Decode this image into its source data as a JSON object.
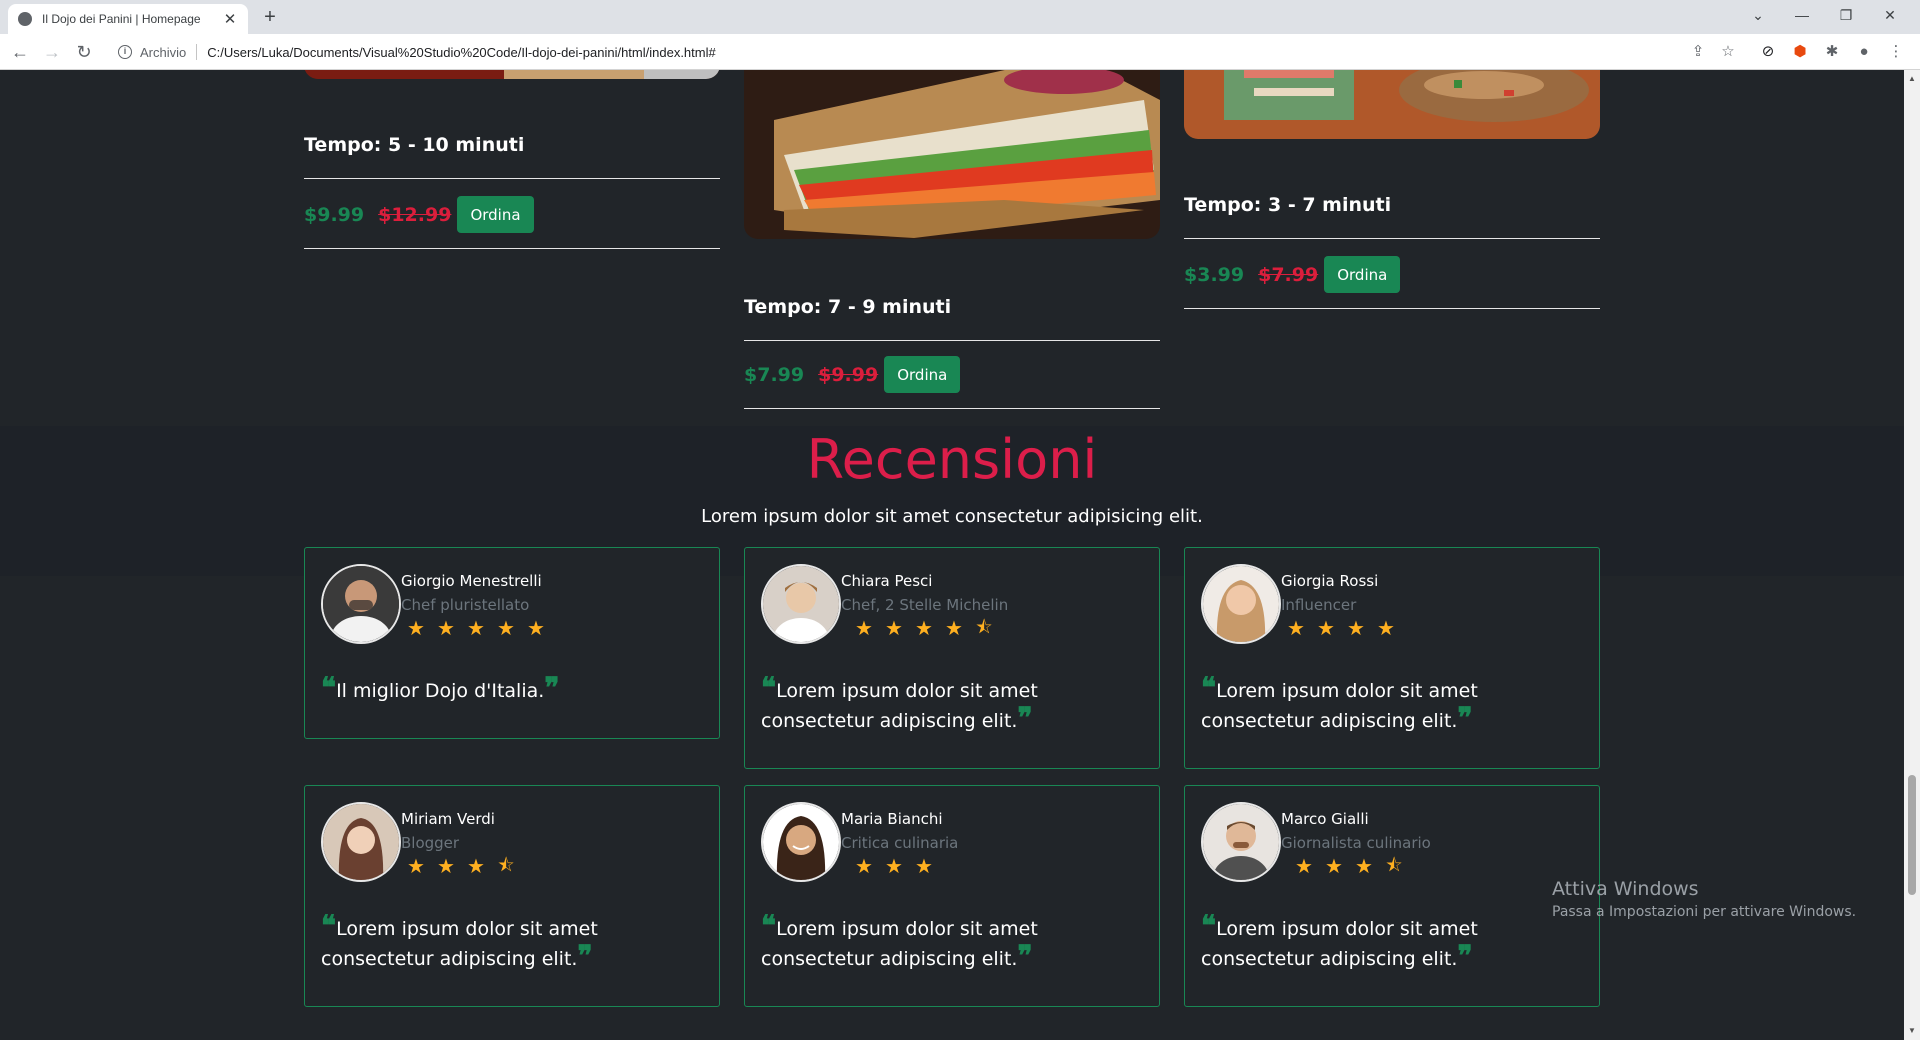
{
  "browser": {
    "tab_title": "Il Dojo dei Panini | Homepage",
    "new_tab": "+",
    "archivio": "Archivio",
    "url": "C:/Users/Luka/Documents/Visual%20Studio%20Code/Il-dojo-dei-panini/html/index.html#"
  },
  "menu": [
    {
      "tempo": "Tempo: 5 - 10 minuti",
      "price": "$9.99",
      "old_price": "$12.99",
      "button": "Ordina"
    },
    {
      "tempo": "Tempo: 7 - 9 minuti",
      "price": "$7.99",
      "old_price": "$9.99",
      "button": "Ordina"
    },
    {
      "tempo": "Tempo: 3 - 7 minuti",
      "price": "$3.99",
      "old_price": "$7.99",
      "button": "Ordina"
    }
  ],
  "reviews_section": {
    "title": "Recensioni",
    "subtitle": "Lorem ipsum dolor sit amet consectetur adipisicing elit."
  },
  "reviews": [
    {
      "name": "Giorgio Menestrelli",
      "role": "Chef pluristellato",
      "rating": 5,
      "quote": "Il miglior Dojo d'Italia."
    },
    {
      "name": "Chiara Pesci",
      "role": "Chef, 2 Stelle Michelin",
      "rating": 4.5,
      "quote": "Lorem ipsum dolor sit amet consectetur adipiscing elit."
    },
    {
      "name": "Giorgia Rossi",
      "role": "Influencer",
      "rating": 4,
      "quote": "Lorem ipsum dolor sit amet consectetur adipiscing elit."
    },
    {
      "name": "Miriam Verdi",
      "role": "Blogger",
      "rating": 3.5,
      "quote": "Lorem ipsum dolor sit amet consectetur adipiscing elit."
    },
    {
      "name": "Maria Bianchi",
      "role": "Critica culinaria",
      "rating": 3,
      "quote": "Lorem ipsum dolor sit amet consectetur adipiscing elit."
    },
    {
      "name": "Marco Gialli",
      "role": "Giornalista culinario",
      "rating": 3.5,
      "quote": "Lorem ipsum dolor sit amet consectetur adipiscing elit."
    }
  ],
  "watermark": {
    "line1": "Attiva Windows",
    "line2": "Passa a Impostazioni per attivare Windows."
  },
  "colors": {
    "accent_green": "#198754",
    "accent_red": "#dc1e4a",
    "star": "#ffb020",
    "page_bg": "#212529"
  }
}
